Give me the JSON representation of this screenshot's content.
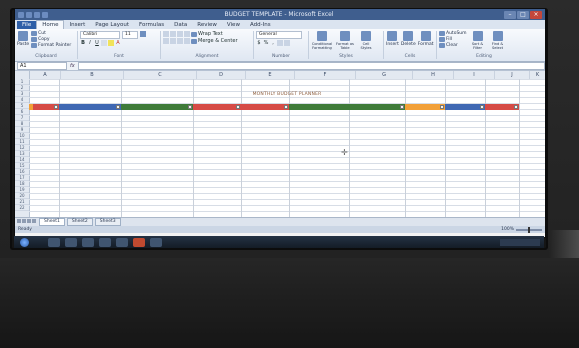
{
  "window": {
    "title": "BUDGET TEMPLATE - Microsoft Excel"
  },
  "ribbon": {
    "tabs": [
      "File",
      "Home",
      "Insert",
      "Page Layout",
      "Formulas",
      "Data",
      "Review",
      "View",
      "Add-Ins"
    ],
    "active_tab": "Home",
    "groups": [
      {
        "label": "Clipboard",
        "buttons": [
          "Paste",
          "Cut",
          "Copy",
          "Format Painter"
        ]
      },
      {
        "label": "Font",
        "font_name": "Calibri",
        "font_size": "11",
        "buttons": [
          "B",
          "I",
          "U"
        ]
      },
      {
        "label": "Alignment",
        "buttons": [
          "Wrap Text",
          "Merge & Center"
        ]
      },
      {
        "label": "Number",
        "format": "General",
        "buttons": [
          "$",
          "%",
          ","
        ]
      },
      {
        "label": "Styles",
        "buttons": [
          "Conditional Formatting",
          "Format as Table",
          "Cell Styles"
        ]
      },
      {
        "label": "Cells",
        "buttons": [
          "Insert",
          "Delete",
          "Format"
        ]
      },
      {
        "label": "Editing",
        "buttons": [
          "AutoSum",
          "Fill",
          "Clear",
          "Sort & Filter",
          "Find & Select"
        ]
      }
    ]
  },
  "formula_bar": {
    "name_box": "A1",
    "fx": "fx",
    "content": ""
  },
  "sheet": {
    "title_text": "MONTHLY BUDGET PLANNER",
    "columns": [
      "A",
      "B",
      "C",
      "D",
      "E",
      "F",
      "G",
      "H",
      "I",
      "J",
      "K"
    ],
    "row_numbers": [
      "1",
      "2",
      "3",
      "4",
      "5",
      "6",
      "7",
      "8",
      "9",
      "10",
      "11",
      "12",
      "13",
      "14",
      "15",
      "16",
      "17",
      "18",
      "19",
      "20",
      "21",
      "22"
    ],
    "header_colors": {
      "red": "#d64b46",
      "blue": "#3f68b3",
      "green": "#3f7b39",
      "orange": "#f2a038"
    }
  },
  "sheet_tabs": {
    "tabs": [
      "Sheet1",
      "Sheet2",
      "Sheet3"
    ],
    "active": "Sheet1"
  },
  "status": {
    "left": "Ready",
    "zoom": "100%"
  }
}
